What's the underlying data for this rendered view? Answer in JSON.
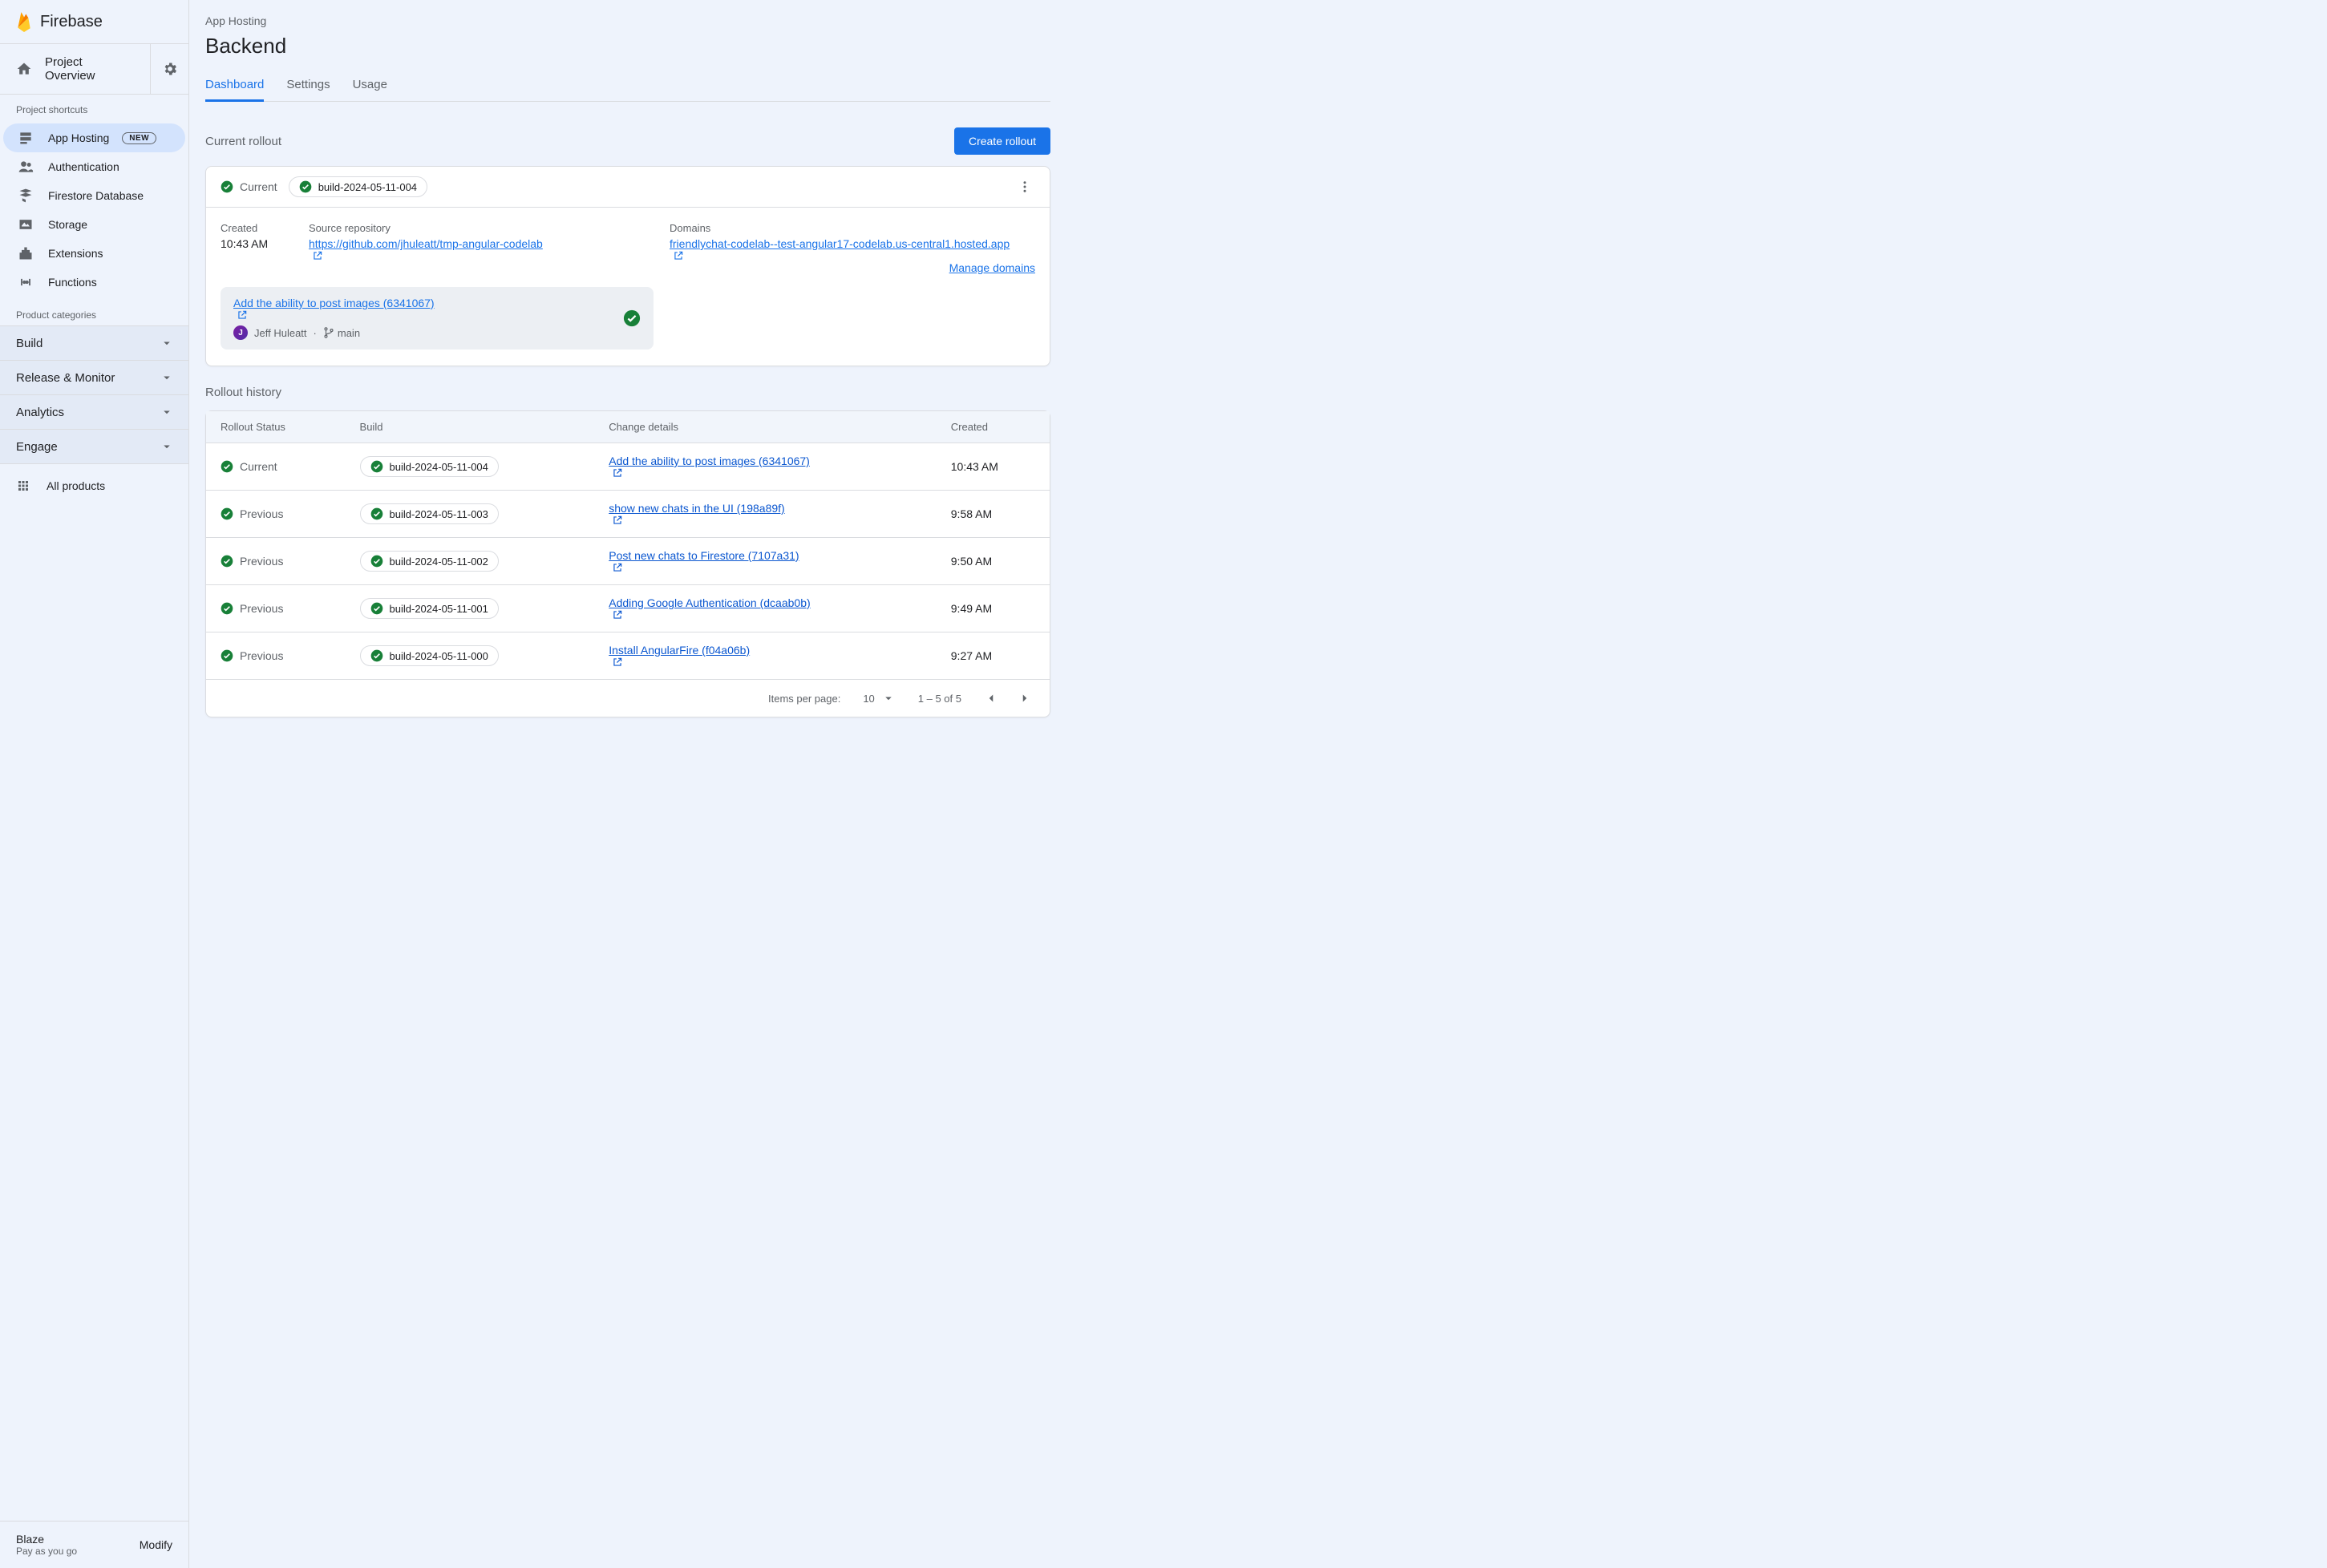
{
  "logo_text": "Firebase",
  "project_overview": "Project Overview",
  "shortcuts_label": "Project shortcuts",
  "new_badge": "NEW",
  "sidebar": {
    "shortcuts": [
      {
        "label": "App Hosting",
        "active": true,
        "new": true,
        "icon": "hosting"
      },
      {
        "label": "Authentication",
        "icon": "people"
      },
      {
        "label": "Firestore Database",
        "icon": "firestore"
      },
      {
        "label": "Storage",
        "icon": "storage"
      },
      {
        "label": "Extensions",
        "icon": "extensions"
      },
      {
        "label": "Functions",
        "icon": "functions"
      }
    ]
  },
  "categories_label": "Product categories",
  "categories": [
    "Build",
    "Release & Monitor",
    "Analytics",
    "Engage"
  ],
  "all_products": "All products",
  "plan": {
    "name": "Blaze",
    "sub": "Pay as you go",
    "modify": "Modify"
  },
  "breadcrumb": "App Hosting",
  "page_title": "Backend",
  "tabs": [
    "Dashboard",
    "Settings",
    "Usage"
  ],
  "active_tab": 0,
  "current_section": "Current rollout",
  "create_button": "Create rollout",
  "current": {
    "status": "Current",
    "build": "build-2024-05-11-004",
    "created_label": "Created",
    "created": "10:43 AM",
    "source_label": "Source repository",
    "source_url": "https://github.com/jhuleatt/tmp-angular-codelab",
    "domains_label": "Domains",
    "domain": "friendlychat-codelab--test-angular17-codelab.us-central1.hosted.app",
    "commit_title": "Add the ability to post images (6341067)",
    "author": "Jeff Huleatt",
    "branch": "main",
    "manage_domains": "Manage domains"
  },
  "history_section": "Rollout history",
  "history_columns": [
    "Rollout Status",
    "Build",
    "Change details",
    "Created"
  ],
  "history": [
    {
      "status": "Current",
      "build": "build-2024-05-11-004",
      "change": "Add the ability to post images (6341067)",
      "created": "10:43 AM"
    },
    {
      "status": "Previous",
      "build": "build-2024-05-11-003",
      "change": "show new chats in the UI (198a89f)",
      "created": "9:58 AM"
    },
    {
      "status": "Previous",
      "build": "build-2024-05-11-002",
      "change": "Post new chats to Firestore (7107a31)",
      "created": "9:50 AM"
    },
    {
      "status": "Previous",
      "build": "build-2024-05-11-001",
      "change": "Adding Google Authentication (dcaab0b)",
      "created": "9:49 AM"
    },
    {
      "status": "Previous",
      "build": "build-2024-05-11-000",
      "change": "Install AngularFire (f04a06b)",
      "created": "9:27 AM"
    }
  ],
  "pagination": {
    "items_per_page_label": "Items per page:",
    "items_per_page": "10",
    "range": "1 – 5 of 5"
  }
}
